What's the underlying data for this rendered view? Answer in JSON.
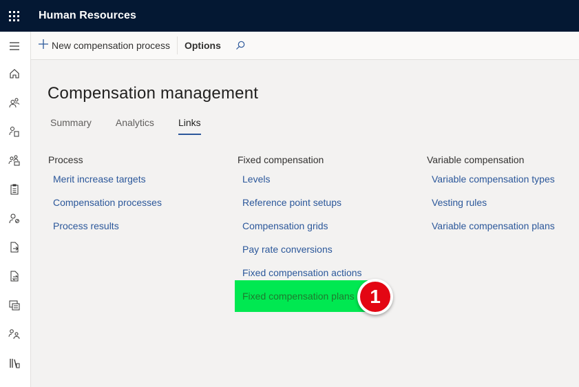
{
  "app": {
    "title": "Human Resources"
  },
  "actionpane": {
    "new_label": "New compensation process",
    "options_label": "Options"
  },
  "page": {
    "title": "Compensation management"
  },
  "tabs": [
    {
      "label": "Summary",
      "active": false
    },
    {
      "label": "Analytics",
      "active": false
    },
    {
      "label": "Links",
      "active": true
    }
  ],
  "columns": [
    {
      "header": "Process",
      "links": [
        "Merit increase targets",
        "Compensation processes",
        "Process results"
      ]
    },
    {
      "header": "Fixed compensation",
      "links": [
        "Levels",
        "Reference point setups",
        "Compensation grids",
        "Pay rate conversions",
        "Fixed compensation actions",
        "Fixed compensation plans"
      ]
    },
    {
      "header": "Variable compensation",
      "links": [
        "Variable compensation types",
        "Vesting rules",
        "Variable compensation plans"
      ]
    }
  ],
  "annotation": {
    "number": "1",
    "highlight_color": "#00e851",
    "badge_color": "#e30613"
  },
  "nav_icons": [
    "home-icon",
    "people-icon",
    "person-document-icon",
    "team-icon",
    "clipboard-icon",
    "person-settings-icon",
    "document-arrow-icon",
    "document-transfer-icon",
    "compensation-icon",
    "people-group-icon",
    "library-icon"
  ],
  "colors": {
    "topbar": "#041833",
    "link": "#2b579a"
  }
}
